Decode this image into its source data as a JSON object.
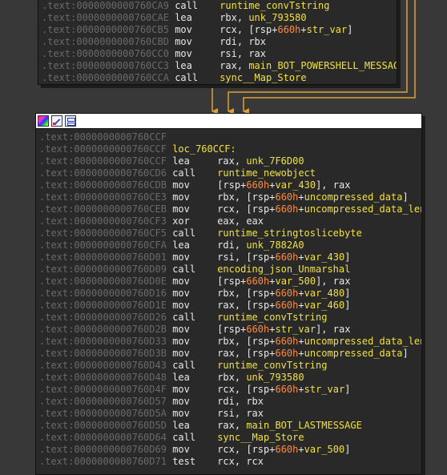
{
  "colors": {
    "edge": "#e0a030",
    "background": "#383838",
    "block": "#292929"
  },
  "top_block": {
    "lines": [
      {
        "addr": ".text:0000000000760CA9",
        "mnemonic": "call",
        "ops": [
          {
            "t": "runtime_convTstring",
            "c": "nm"
          }
        ]
      },
      {
        "addr": ".text:0000000000760CAE",
        "mnemonic": "lea",
        "ops": [
          {
            "t": "rbx",
            "c": "reg"
          },
          {
            "t": ", ",
            "c": "op"
          },
          {
            "t": "unk_793580",
            "c": "nm"
          }
        ]
      },
      {
        "addr": ".text:0000000000760CB5",
        "mnemonic": "mov",
        "ops": [
          {
            "t": "rcx",
            "c": "reg"
          },
          {
            "t": ", [",
            "c": "op"
          },
          {
            "t": "rsp",
            "c": "reg"
          },
          {
            "t": "+",
            "c": "op"
          },
          {
            "t": "660h",
            "c": "of"
          },
          {
            "t": "+",
            "c": "op"
          },
          {
            "t": "str_var",
            "c": "nm"
          },
          {
            "t": "]",
            "c": "op"
          }
        ]
      },
      {
        "addr": ".text:0000000000760CBD",
        "mnemonic": "mov",
        "ops": [
          {
            "t": "rdi",
            "c": "reg"
          },
          {
            "t": ", ",
            "c": "op"
          },
          {
            "t": "rbx",
            "c": "reg"
          }
        ]
      },
      {
        "addr": ".text:0000000000760CC0",
        "mnemonic": "mov",
        "ops": [
          {
            "t": "rsi",
            "c": "reg"
          },
          {
            "t": ", ",
            "c": "op"
          },
          {
            "t": "rax",
            "c": "reg"
          }
        ]
      },
      {
        "addr": ".text:0000000000760CC3",
        "mnemonic": "lea",
        "ops": [
          {
            "t": "rax",
            "c": "reg"
          },
          {
            "t": ", ",
            "c": "op"
          },
          {
            "t": "main_BOT_POWERSHELL_MESSAGE",
            "c": "nm"
          }
        ]
      },
      {
        "addr": ".text:0000000000760CCA",
        "mnemonic": "call",
        "ops": [
          {
            "t": "sync__Map_Store",
            "c": "nm"
          }
        ]
      }
    ]
  },
  "main_block": {
    "lines": [
      {
        "addr": ".text:0000000000760CCF",
        "mnemonic": "",
        "ops": []
      },
      {
        "addr": ".text:0000000000760CCF",
        "label": "loc_760CCF:",
        "mnemonic": "",
        "ops": []
      },
      {
        "addr": ".text:0000000000760CCF",
        "mnemonic": "lea",
        "ops": [
          {
            "t": "rax",
            "c": "reg"
          },
          {
            "t": ", ",
            "c": "op"
          },
          {
            "t": "unk_7F6D00",
            "c": "nm"
          }
        ]
      },
      {
        "addr": ".text:0000000000760CD6",
        "mnemonic": "call",
        "ops": [
          {
            "t": "runtime_newobject",
            "c": "nm"
          }
        ]
      },
      {
        "addr": ".text:0000000000760CDB",
        "mnemonic": "mov",
        "ops": [
          {
            "t": "[",
            "c": "op"
          },
          {
            "t": "rsp",
            "c": "reg"
          },
          {
            "t": "+",
            "c": "op"
          },
          {
            "t": "660h",
            "c": "of"
          },
          {
            "t": "+",
            "c": "op"
          },
          {
            "t": "var_430",
            "c": "nm"
          },
          {
            "t": "], ",
            "c": "op"
          },
          {
            "t": "rax",
            "c": "reg"
          }
        ]
      },
      {
        "addr": ".text:0000000000760CE3",
        "mnemonic": "mov",
        "ops": [
          {
            "t": "rbx",
            "c": "reg"
          },
          {
            "t": ", [",
            "c": "op"
          },
          {
            "t": "rsp",
            "c": "reg"
          },
          {
            "t": "+",
            "c": "op"
          },
          {
            "t": "660h",
            "c": "of"
          },
          {
            "t": "+",
            "c": "op"
          },
          {
            "t": "uncompressed_data",
            "c": "nm"
          },
          {
            "t": "]",
            "c": "op"
          }
        ]
      },
      {
        "addr": ".text:0000000000760CEB",
        "mnemonic": "mov",
        "ops": [
          {
            "t": "rcx",
            "c": "reg"
          },
          {
            "t": ", [",
            "c": "op"
          },
          {
            "t": "rsp",
            "c": "reg"
          },
          {
            "t": "+",
            "c": "op"
          },
          {
            "t": "660h",
            "c": "of"
          },
          {
            "t": "+",
            "c": "op"
          },
          {
            "t": "uncompressed_data_len",
            "c": "nm"
          },
          {
            "t": "]",
            "c": "op"
          }
        ]
      },
      {
        "addr": ".text:0000000000760CF3",
        "mnemonic": "xor",
        "ops": [
          {
            "t": "eax",
            "c": "reg"
          },
          {
            "t": ", ",
            "c": "op"
          },
          {
            "t": "eax",
            "c": "reg"
          }
        ]
      },
      {
        "addr": ".text:0000000000760CF5",
        "mnemonic": "call",
        "ops": [
          {
            "t": "runtime_stringtoslicebyte",
            "c": "nm"
          }
        ]
      },
      {
        "addr": ".text:0000000000760CFA",
        "mnemonic": "lea",
        "ops": [
          {
            "t": "rdi",
            "c": "reg"
          },
          {
            "t": ", ",
            "c": "op"
          },
          {
            "t": "unk_7882A0",
            "c": "nm"
          }
        ]
      },
      {
        "addr": ".text:0000000000760D01",
        "mnemonic": "mov",
        "ops": [
          {
            "t": "rsi",
            "c": "reg"
          },
          {
            "t": ", [",
            "c": "op"
          },
          {
            "t": "rsp",
            "c": "reg"
          },
          {
            "t": "+",
            "c": "op"
          },
          {
            "t": "660h",
            "c": "of"
          },
          {
            "t": "+",
            "c": "op"
          },
          {
            "t": "var_430",
            "c": "nm"
          },
          {
            "t": "]",
            "c": "op"
          }
        ]
      },
      {
        "addr": ".text:0000000000760D09",
        "mnemonic": "call",
        "ops": [
          {
            "t": "encoding_json_Unmarshal",
            "c": "nm"
          }
        ]
      },
      {
        "addr": ".text:0000000000760D0E",
        "mnemonic": "mov",
        "ops": [
          {
            "t": "[",
            "c": "op"
          },
          {
            "t": "rsp",
            "c": "reg"
          },
          {
            "t": "+",
            "c": "op"
          },
          {
            "t": "660h",
            "c": "of"
          },
          {
            "t": "+",
            "c": "op"
          },
          {
            "t": "var_500",
            "c": "nm"
          },
          {
            "t": "], ",
            "c": "op"
          },
          {
            "t": "rax",
            "c": "reg"
          }
        ]
      },
      {
        "addr": ".text:0000000000760D16",
        "mnemonic": "mov",
        "ops": [
          {
            "t": "rbx",
            "c": "reg"
          },
          {
            "t": ", [",
            "c": "op"
          },
          {
            "t": "rsp",
            "c": "reg"
          },
          {
            "t": "+",
            "c": "op"
          },
          {
            "t": "660h",
            "c": "of"
          },
          {
            "t": "+",
            "c": "op"
          },
          {
            "t": "var_480",
            "c": "nm"
          },
          {
            "t": "]",
            "c": "op"
          }
        ]
      },
      {
        "addr": ".text:0000000000760D1E",
        "mnemonic": "mov",
        "ops": [
          {
            "t": "rax",
            "c": "reg"
          },
          {
            "t": ", [",
            "c": "op"
          },
          {
            "t": "rsp",
            "c": "reg"
          },
          {
            "t": "+",
            "c": "op"
          },
          {
            "t": "660h",
            "c": "of"
          },
          {
            "t": "+",
            "c": "op"
          },
          {
            "t": "var_460",
            "c": "nm"
          },
          {
            "t": "]",
            "c": "op"
          }
        ]
      },
      {
        "addr": ".text:0000000000760D26",
        "mnemonic": "call",
        "ops": [
          {
            "t": "runtime_convTstring",
            "c": "nm"
          }
        ]
      },
      {
        "addr": ".text:0000000000760D2B",
        "mnemonic": "mov",
        "ops": [
          {
            "t": "[",
            "c": "op"
          },
          {
            "t": "rsp",
            "c": "reg"
          },
          {
            "t": "+",
            "c": "op"
          },
          {
            "t": "660h",
            "c": "of"
          },
          {
            "t": "+",
            "c": "op"
          },
          {
            "t": "str_var",
            "c": "nm"
          },
          {
            "t": "], ",
            "c": "op"
          },
          {
            "t": "rax",
            "c": "reg"
          }
        ]
      },
      {
        "addr": ".text:0000000000760D33",
        "mnemonic": "mov",
        "ops": [
          {
            "t": "rbx",
            "c": "reg"
          },
          {
            "t": ", [",
            "c": "op"
          },
          {
            "t": "rsp",
            "c": "reg"
          },
          {
            "t": "+",
            "c": "op"
          },
          {
            "t": "660h",
            "c": "of"
          },
          {
            "t": "+",
            "c": "op"
          },
          {
            "t": "uncompressed_data_len",
            "c": "nm"
          },
          {
            "t": "]",
            "c": "op"
          }
        ]
      },
      {
        "addr": ".text:0000000000760D3B",
        "mnemonic": "mov",
        "ops": [
          {
            "t": "rax",
            "c": "reg"
          },
          {
            "t": ", [",
            "c": "op"
          },
          {
            "t": "rsp",
            "c": "reg"
          },
          {
            "t": "+",
            "c": "op"
          },
          {
            "t": "660h",
            "c": "of"
          },
          {
            "t": "+",
            "c": "op"
          },
          {
            "t": "uncompressed_data",
            "c": "nm"
          },
          {
            "t": "]",
            "c": "op"
          }
        ]
      },
      {
        "addr": ".text:0000000000760D43",
        "mnemonic": "call",
        "ops": [
          {
            "t": "runtime_convTstring",
            "c": "nm"
          }
        ]
      },
      {
        "addr": ".text:0000000000760D48",
        "mnemonic": "lea",
        "ops": [
          {
            "t": "rbx",
            "c": "reg"
          },
          {
            "t": ", ",
            "c": "op"
          },
          {
            "t": "unk_793580",
            "c": "nm"
          }
        ]
      },
      {
        "addr": ".text:0000000000760D4F",
        "mnemonic": "mov",
        "ops": [
          {
            "t": "rcx",
            "c": "reg"
          },
          {
            "t": ", [",
            "c": "op"
          },
          {
            "t": "rsp",
            "c": "reg"
          },
          {
            "t": "+",
            "c": "op"
          },
          {
            "t": "660h",
            "c": "of"
          },
          {
            "t": "+",
            "c": "op"
          },
          {
            "t": "str_var",
            "c": "nm"
          },
          {
            "t": "]",
            "c": "op"
          }
        ]
      },
      {
        "addr": ".text:0000000000760D57",
        "mnemonic": "mov",
        "ops": [
          {
            "t": "rdi",
            "c": "reg"
          },
          {
            "t": ", ",
            "c": "op"
          },
          {
            "t": "rbx",
            "c": "reg"
          }
        ]
      },
      {
        "addr": ".text:0000000000760D5A",
        "mnemonic": "mov",
        "ops": [
          {
            "t": "rsi",
            "c": "reg"
          },
          {
            "t": ", ",
            "c": "op"
          },
          {
            "t": "rax",
            "c": "reg"
          }
        ]
      },
      {
        "addr": ".text:0000000000760D5D",
        "mnemonic": "lea",
        "ops": [
          {
            "t": "rax",
            "c": "reg"
          },
          {
            "t": ", ",
            "c": "op"
          },
          {
            "t": "main_BOT_LASTMESSAGE",
            "c": "nm"
          }
        ]
      },
      {
        "addr": ".text:0000000000760D64",
        "mnemonic": "call",
        "ops": [
          {
            "t": "sync__Map_Store",
            "c": "nm"
          }
        ]
      },
      {
        "addr": ".text:0000000000760D69",
        "mnemonic": "mov",
        "ops": [
          {
            "t": "rcx",
            "c": "reg"
          },
          {
            "t": ", [",
            "c": "op"
          },
          {
            "t": "rsp",
            "c": "reg"
          },
          {
            "t": "+",
            "c": "op"
          },
          {
            "t": "660h",
            "c": "of"
          },
          {
            "t": "+",
            "c": "op"
          },
          {
            "t": "var_500",
            "c": "nm"
          },
          {
            "t": "]",
            "c": "op"
          }
        ]
      },
      {
        "addr": ".text:0000000000760D71",
        "mnemonic": "test",
        "ops": [
          {
            "t": "rcx",
            "c": "reg"
          },
          {
            "t": ", ",
            "c": "op"
          },
          {
            "t": "rcx",
            "c": "reg"
          }
        ]
      }
    ]
  }
}
